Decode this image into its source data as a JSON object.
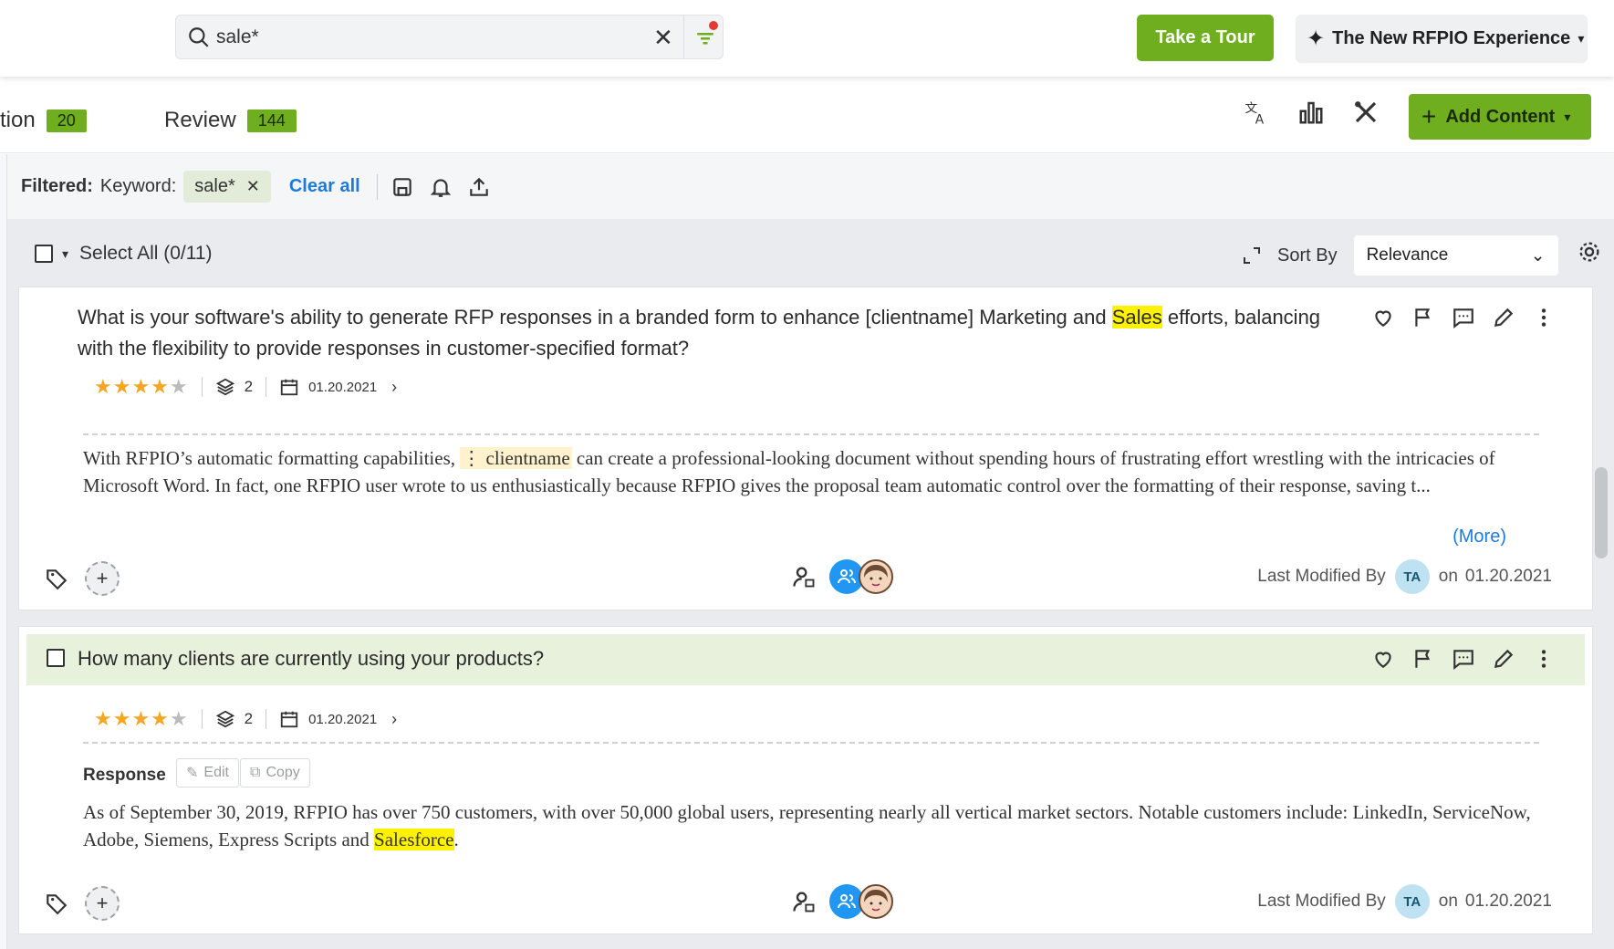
{
  "search": {
    "value": "sale*"
  },
  "header": {
    "tour_label": "Take a Tour",
    "experience_label": "The New RFPIO Experience"
  },
  "tabs": [
    {
      "label": "tion",
      "count": "20"
    },
    {
      "label": "Review",
      "count": "144"
    }
  ],
  "toolbar": {
    "add_content_label": "Add Content"
  },
  "filters": {
    "filtered_label": "Filtered:",
    "keyword_label": "Keyword:",
    "chip_value": "sale*",
    "clear_all": "Clear all"
  },
  "list": {
    "select_all": "Select All (0/11)",
    "sort_by_label": "Sort By",
    "sort_value": "Relevance"
  },
  "cards": [
    {
      "title_before": "What is your software's ability to generate RFP responses in a branded form to enhance [clientname] Marketing and ",
      "title_highlight": "Sales",
      "title_after": " efforts, balancing with the flexibility to provide responses in customer-specified format?",
      "rating": 4,
      "versions": "2",
      "date": "01.20.2021",
      "body_before": "With RFPIO’s automatic formatting capabilities, ",
      "body_tag": "clientname",
      "body_after": " can create a professional-looking document without spending hours of frustrating effort wrestling with the intricacies of Microsoft Word. In fact, one RFPIO user wrote to us enthusiastically because RFPIO gives the proposal team automatic control over the formatting of their response, saving t...",
      "more_label": "(More)",
      "last_modified_label": "Last Modified By",
      "initials": "TA",
      "on_label": "on",
      "modified_date": "01.20.2021"
    },
    {
      "title": "How many clients are currently using your products?",
      "rating": 4,
      "versions": "2",
      "date": "01.20.2021",
      "response_label": "Response",
      "edit_label": "Edit",
      "copy_label": "Copy",
      "body_before": "As of September 30, 2019, RFPIO has over 750 customers, with over 50,000 global users, representing nearly all vertical market sectors. Notable customers include: LinkedIn, ServiceNow, Adobe, Siemens, Express Scripts and ",
      "body_highlight": "Salesforce",
      "body_after": ".",
      "last_modified_label": "Last Modified By",
      "initials": "TA",
      "on_label": "on",
      "modified_date": "01.20.2021"
    }
  ],
  "colors": {
    "accent_green": "#6fae1f",
    "link_blue": "#1e7ad8",
    "highlight": "#fff200",
    "star": "#f5a623"
  }
}
